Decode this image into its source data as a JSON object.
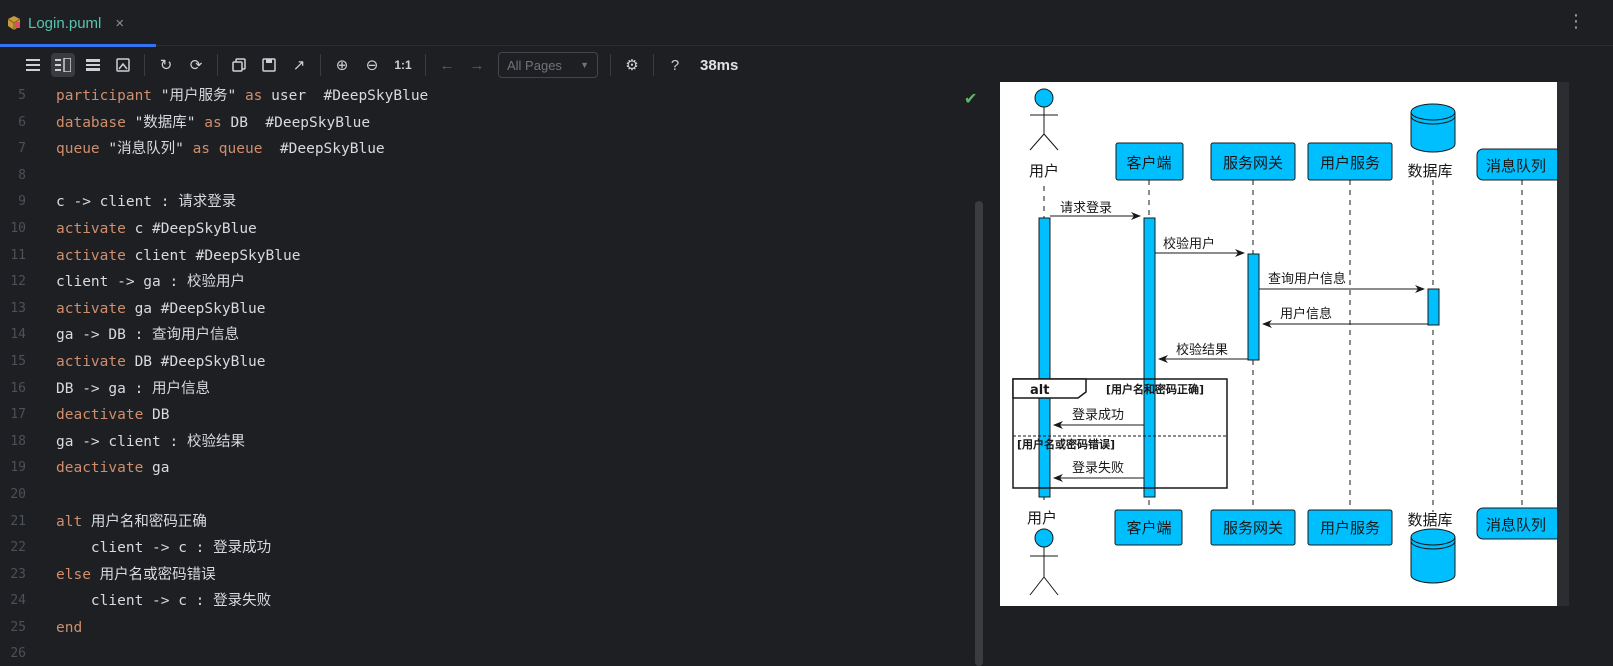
{
  "tab": {
    "title": "Login.puml",
    "close": "×"
  },
  "menu": {
    "more": "⋮"
  },
  "toolbar": {
    "pages_value": "All Pages",
    "zoom_reset": "1:1",
    "help": "?",
    "timing": "38ms"
  },
  "editor": {
    "line_numbers": [
      "5",
      "6",
      "7",
      "8",
      "9",
      "10",
      "11",
      "12",
      "13",
      "14",
      "15",
      "16",
      "17",
      "18",
      "19",
      "20",
      "21",
      "22",
      "23",
      "24",
      "25",
      "26"
    ],
    "lines": [
      [
        {
          "t": "participant",
          "c": "kw"
        },
        {
          "t": " \"用户服务\" ",
          "c": "str"
        },
        {
          "t": "as",
          "c": "kw"
        },
        {
          "t": " user  #DeepSkyBlue",
          "c": "str"
        }
      ],
      [
        {
          "t": "database",
          "c": "kw"
        },
        {
          "t": " \"数据库\" ",
          "c": "str"
        },
        {
          "t": "as",
          "c": "kw"
        },
        {
          "t": " DB  #DeepSkyBlue",
          "c": "str"
        }
      ],
      [
        {
          "t": "queue",
          "c": "kw"
        },
        {
          "t": " \"消息队列\" ",
          "c": "str"
        },
        {
          "t": "as",
          "c": "kw"
        },
        {
          "t": " ",
          "c": "str"
        },
        {
          "t": "queue",
          "c": "kw"
        },
        {
          "t": "  #DeepSkyBlue",
          "c": "str"
        }
      ],
      [],
      [
        {
          "t": "c -> client : 请求登录",
          "c": "str"
        }
      ],
      [
        {
          "t": "activate",
          "c": "kw"
        },
        {
          "t": " c #DeepSkyBlue",
          "c": "str"
        }
      ],
      [
        {
          "t": "activate",
          "c": "kw"
        },
        {
          "t": " client #DeepSkyBlue",
          "c": "str"
        }
      ],
      [
        {
          "t": "client -> ga : 校验用户",
          "c": "str"
        }
      ],
      [
        {
          "t": "activate",
          "c": "kw"
        },
        {
          "t": " ga #DeepSkyBlue",
          "c": "str"
        }
      ],
      [
        {
          "t": "ga -> DB : 查询用户信息",
          "c": "str"
        }
      ],
      [
        {
          "t": "activate",
          "c": "kw"
        },
        {
          "t": " DB #DeepSkyBlue",
          "c": "str"
        }
      ],
      [
        {
          "t": "DB -> ga : 用户信息",
          "c": "str"
        }
      ],
      [
        {
          "t": "deactivate",
          "c": "kw"
        },
        {
          "t": " DB",
          "c": "str"
        }
      ],
      [
        {
          "t": "ga -> client : 校验结果",
          "c": "str"
        }
      ],
      [
        {
          "t": "deactivate",
          "c": "kw"
        },
        {
          "t": " ga",
          "c": "str"
        }
      ],
      [],
      [
        {
          "t": "alt",
          "c": "kw"
        },
        {
          "t": " 用户名和密码正确",
          "c": "str"
        }
      ],
      [
        {
          "t": "    client -> c : 登录成功",
          "c": "str"
        }
      ],
      [
        {
          "t": "else",
          "c": "kw"
        },
        {
          "t": " 用户名或密码错误",
          "c": "str"
        }
      ],
      [
        {
          "t": "    client -> c : 登录失败",
          "c": "str"
        }
      ],
      [
        {
          "t": "end",
          "c": "kw"
        }
      ],
      []
    ]
  },
  "diagram": {
    "participants": {
      "user": "用户",
      "client": "客户端",
      "ga": "服务网关",
      "us": "用户服务",
      "db": "数据库",
      "mq": "消息队列"
    },
    "messages": {
      "m1": "请求登录",
      "m2": "校验用户",
      "m3": "查询用户信息",
      "m4": "用户信息",
      "m5": "校验结果",
      "m6": "登录成功",
      "m7": "登录失败"
    },
    "alt": {
      "label": "alt",
      "guard1": "[用户名和密码正确]",
      "guard2": "[用户名或密码错误]"
    }
  },
  "colors": {
    "participant_fill": "#00bfff",
    "keyword": "#cf8e6d",
    "accent": "#3574f0"
  }
}
